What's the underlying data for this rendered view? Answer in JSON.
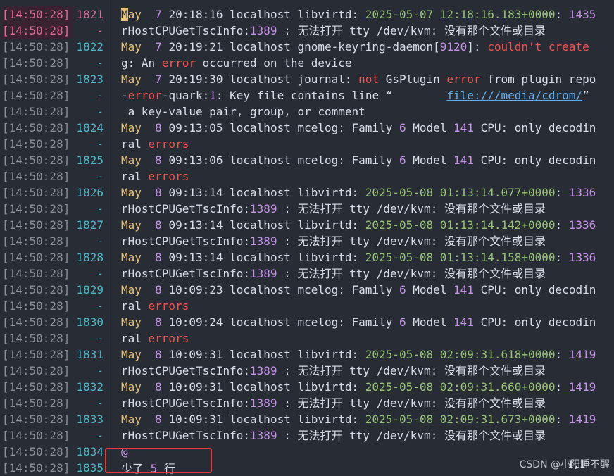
{
  "timestamp": "[14:50:28]",
  "dash": "-",
  "rows": [
    {
      "ln": "1821",
      "cur": true,
      "content": [
        [
          "cursor",
          "M"
        ],
        [
          "month",
          "ay"
        ],
        [
          "",
          "  "
        ],
        [
          "num",
          "7"
        ],
        [
          "",
          " 20:18:16 localhost libvirtd"
        ],
        [
          "",
          ": "
        ],
        [
          "grn",
          "2025-05-07 12:18:16.183+0000"
        ],
        [
          "",
          ": "
        ],
        [
          "num",
          "1435"
        ]
      ]
    },
    {
      "ln": "-",
      "cur": true,
      "content": [
        [
          "",
          "rHostCPUGetTscInfo"
        ],
        [
          "",
          ":"
        ],
        [
          "num",
          "1389"
        ],
        [
          "",
          " : 无法打开 tty /dev/kvm: 没有那个文件或目录"
        ]
      ]
    },
    {
      "ln": "1822",
      "content": [
        [
          "month",
          "May"
        ],
        [
          "",
          "  "
        ],
        [
          "num",
          "7"
        ],
        [
          "",
          " 20:19:21 localhost gnome-keyring-daemon["
        ],
        [
          "num",
          "9120"
        ],
        [
          "",
          "]"
        ],
        [
          "",
          ": "
        ],
        [
          "err",
          "couldn't"
        ],
        [
          "",
          ""
        ],
        [
          "err",
          " create"
        ]
      ]
    },
    {
      "ln": "-",
      "content": [
        [
          "",
          "g: An "
        ],
        [
          "err",
          "error"
        ],
        [
          "",
          " occurred on the device"
        ]
      ]
    },
    {
      "ln": "1823",
      "content": [
        [
          "month",
          "May"
        ],
        [
          "",
          "  "
        ],
        [
          "num",
          "7"
        ],
        [
          "",
          " 20:19:30 localhost journal"
        ],
        [
          "",
          ": "
        ],
        [
          "err",
          "not"
        ],
        [
          "",
          " GsPlugin "
        ],
        [
          "err",
          "error"
        ],
        [
          "",
          " from plugin repo"
        ]
      ]
    },
    {
      "ln": "-",
      "content": [
        [
          "",
          "-"
        ],
        [
          "err",
          "error"
        ],
        [
          "",
          "-quark:"
        ],
        [
          "num",
          "1"
        ],
        [
          "",
          ": Key file contains line “        "
        ],
        [
          "link",
          "file:///media/cdrom/"
        ],
        [
          "",
          "”"
        ]
      ]
    },
    {
      "ln": "-",
      "content": [
        [
          "",
          " a key-value pair, group, or comment"
        ]
      ]
    },
    {
      "ln": "1824",
      "content": [
        [
          "month",
          "May"
        ],
        [
          "",
          "  "
        ],
        [
          "num",
          "8"
        ],
        [
          "",
          " 09:13:05 localhost mcelog: Family "
        ],
        [
          "num",
          "6"
        ],
        [
          "",
          " Model "
        ],
        [
          "num",
          "141"
        ],
        [
          "",
          " CPU: only decodin"
        ]
      ]
    },
    {
      "ln": "-",
      "content": [
        [
          "",
          "ral "
        ],
        [
          "err",
          "errors"
        ]
      ]
    },
    {
      "ln": "1825",
      "content": [
        [
          "month",
          "May"
        ],
        [
          "",
          "  "
        ],
        [
          "num",
          "8"
        ],
        [
          "",
          " 09:13:06 localhost mcelog: Family "
        ],
        [
          "num",
          "6"
        ],
        [
          "",
          " Model "
        ],
        [
          "num",
          "141"
        ],
        [
          "",
          " CPU: only decodin"
        ]
      ]
    },
    {
      "ln": "-",
      "content": [
        [
          "",
          "ral "
        ],
        [
          "err",
          "errors"
        ]
      ]
    },
    {
      "ln": "1826",
      "content": [
        [
          "month",
          "May"
        ],
        [
          "",
          "  "
        ],
        [
          "num",
          "8"
        ],
        [
          "",
          " 09:13:14 localhost libvirtd: "
        ],
        [
          "grn",
          "2025-05-08 01:13:14.077+0000"
        ],
        [
          "",
          ": "
        ],
        [
          "num",
          "1336"
        ]
      ]
    },
    {
      "ln": "-",
      "content": [
        [
          "",
          "rHostCPUGetTscInfo:"
        ],
        [
          "num",
          "1389"
        ],
        [
          "",
          " : 无法打开 tty /dev/kvm: 没有那个文件或目录"
        ]
      ]
    },
    {
      "ln": "1827",
      "content": [
        [
          "month",
          "May"
        ],
        [
          "",
          "  "
        ],
        [
          "num",
          "8"
        ],
        [
          "",
          " 09:13:14 localhost libvirtd: "
        ],
        [
          "grn",
          "2025-05-08 01:13:14.142+0000"
        ],
        [
          "",
          ": "
        ],
        [
          "num",
          "1336"
        ]
      ]
    },
    {
      "ln": "-",
      "content": [
        [
          "",
          "rHostCPUGetTscInfo:"
        ],
        [
          "num",
          "1389"
        ],
        [
          "",
          " : 无法打开 tty /dev/kvm: 没有那个文件或目录"
        ]
      ]
    },
    {
      "ln": "1828",
      "content": [
        [
          "month",
          "May"
        ],
        [
          "",
          "  "
        ],
        [
          "num",
          "8"
        ],
        [
          "",
          " 09:13:14 localhost libvirtd: "
        ],
        [
          "grn",
          "2025-05-08 01:13:14.158+0000"
        ],
        [
          "",
          ": "
        ],
        [
          "num",
          "1336"
        ]
      ]
    },
    {
      "ln": "-",
      "content": [
        [
          "",
          "rHostCPUGetTscInfo:"
        ],
        [
          "num",
          "1389"
        ],
        [
          "",
          " : 无法打开 tty /dev/kvm: 没有那个文件或目录"
        ]
      ]
    },
    {
      "ln": "1829",
      "content": [
        [
          "month",
          "May"
        ],
        [
          "",
          "  "
        ],
        [
          "num",
          "8"
        ],
        [
          "",
          " 10:09:23 localhost mcelog: Family "
        ],
        [
          "num",
          "6"
        ],
        [
          "",
          " Model "
        ],
        [
          "num",
          "141"
        ],
        [
          "",
          " CPU: only decodin"
        ]
      ]
    },
    {
      "ln": "-",
      "content": [
        [
          "",
          "ral "
        ],
        [
          "err",
          "errors"
        ]
      ]
    },
    {
      "ln": "1830",
      "content": [
        [
          "month",
          "May"
        ],
        [
          "",
          "  "
        ],
        [
          "num",
          "8"
        ],
        [
          "",
          " 10:09:24 localhost mcelog: Family "
        ],
        [
          "num",
          "6"
        ],
        [
          "",
          " Model "
        ],
        [
          "num",
          "141"
        ],
        [
          "",
          " CPU: only decodin"
        ]
      ]
    },
    {
      "ln": "-",
      "content": [
        [
          "",
          "ral "
        ],
        [
          "err",
          "errors"
        ]
      ]
    },
    {
      "ln": "1831",
      "content": [
        [
          "month",
          "May"
        ],
        [
          "",
          "  "
        ],
        [
          "num",
          "8"
        ],
        [
          "",
          " 10:09:31 localhost libvirtd: "
        ],
        [
          "grn",
          "2025-05-08 02:09:31.618+0000"
        ],
        [
          "",
          ": "
        ],
        [
          "num",
          "1419"
        ]
      ]
    },
    {
      "ln": "-",
      "content": [
        [
          "",
          "rHostCPUGetTscInfo:"
        ],
        [
          "num",
          "1389"
        ],
        [
          "",
          " : 无法打开 tty /dev/kvm: 没有那个文件或目录"
        ]
      ]
    },
    {
      "ln": "1832",
      "content": [
        [
          "month",
          "May"
        ],
        [
          "",
          "  "
        ],
        [
          "num",
          "8"
        ],
        [
          "",
          " 10:09:31 localhost libvirtd: "
        ],
        [
          "grn",
          "2025-05-08 02:09:31.660+0000"
        ],
        [
          "",
          ": "
        ],
        [
          "num",
          "1419"
        ]
      ]
    },
    {
      "ln": "-",
      "content": [
        [
          "",
          "rHostCPUGetTscInfo:"
        ],
        [
          "num",
          "1389"
        ],
        [
          "",
          " : 无法打开 tty /dev/kvm: 没有那个文件或目录"
        ]
      ]
    },
    {
      "ln": "1833",
      "content": [
        [
          "month",
          "May"
        ],
        [
          "",
          "  "
        ],
        [
          "num",
          "8"
        ],
        [
          "",
          " 10:09:31 localhost libvirtd: "
        ],
        [
          "grn",
          "2025-05-08 02:09:31.673+0000"
        ],
        [
          "",
          ": "
        ],
        [
          "num",
          "1419"
        ]
      ]
    },
    {
      "ln": "-",
      "content": [
        [
          "",
          "rHostCPUGetTscInfo:"
        ],
        [
          "num",
          "1389"
        ],
        [
          "",
          " : 无法打开 tty /dev/kvm: 没有那个文件或目录"
        ]
      ]
    },
    {
      "ln": "1834",
      "content": [
        [
          "purple",
          "@"
        ]
      ]
    },
    {
      "ln": "1835",
      "content": []
    }
  ],
  "status_line": {
    "before": "少了 ",
    "count": "5",
    "after": " 行"
  },
  "cursor_pos": "1,1",
  "watermark": "CSDN @小阳睡不醒"
}
